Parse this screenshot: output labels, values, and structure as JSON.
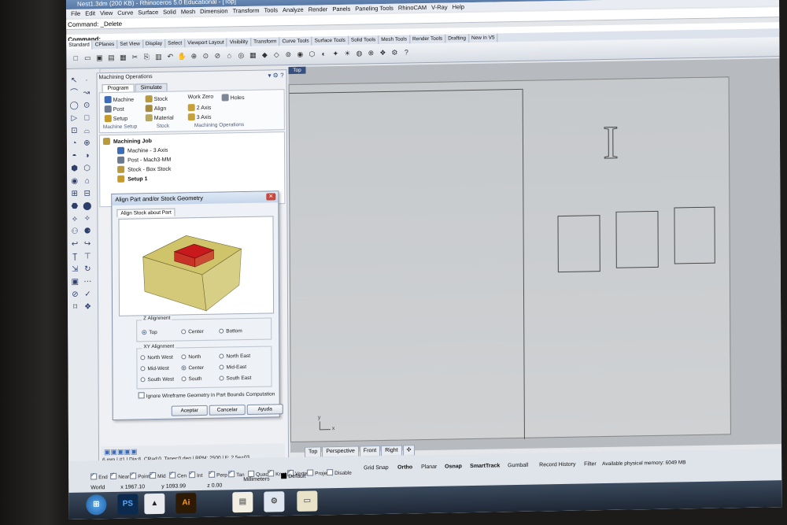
{
  "window": {
    "title": "Nest1.3dm (200 KB) - Rhinoceros 5.0 Educational - [Top]"
  },
  "menu": [
    "File",
    "Edit",
    "View",
    "Curve",
    "Surface",
    "Solid",
    "Mesh",
    "Dimension",
    "Transform",
    "Tools",
    "Analyze",
    "Render",
    "Panels",
    "Paneling Tools",
    "RhinoCAM",
    "V-Ray",
    "Help"
  ],
  "command_history": "Command: _Delete",
  "command_prompt": "Command:",
  "toolbar_tabs": [
    "Standard",
    "CPlanes",
    "Set View",
    "Display",
    "Select",
    "Viewport Layout",
    "Visibility",
    "Transform",
    "Curve Tools",
    "Surface Tools",
    "Solid Tools",
    "Mesh Tools",
    "Render Tools",
    "Drafting",
    "New in V5"
  ],
  "panel": {
    "title": "Machining Operations",
    "tabs": [
      "Program",
      "Simulate"
    ],
    "ribbon": {
      "machine": "Machine",
      "post": "Post",
      "setup": "Setup",
      "stock": "Stock",
      "align": "Align",
      "material": "Material",
      "work_zero": "Work Zero",
      "holes": "Holes",
      "two_axis": "2 Axis",
      "three_axis": "3 Axis",
      "group_setup": "Machine Setup",
      "group_stock": "Stock",
      "group_ops": "Machining Operations"
    },
    "tree": {
      "root": "Machining Job",
      "items": [
        "Machine - 3 Axis",
        "Post - Mach3-MM",
        "Stock - Box Stock",
        "Setup 1"
      ]
    },
    "status_line": "6 mm | #1 | Dia:6, CRad:0, Taper:0 deg | RPM: 2500 | F: 2.5e+03"
  },
  "dialog": {
    "title": "Align Part and/or Stock Geometry",
    "tab": "Align Stock about Part",
    "z_alignment": {
      "label": "Z Alignment",
      "options": [
        "Top",
        "Center",
        "Bottom"
      ],
      "selected": "Top"
    },
    "xy_alignment": {
      "label": "XY Alignment",
      "options": [
        "North West",
        "North",
        "North East",
        "Mid-West",
        "Center",
        "Mid-East",
        "South West",
        "South",
        "South East"
      ],
      "selected": "Center"
    },
    "ignore_label": "Ignore Wireframe Geometry in Part Bounds Computation",
    "buttons": {
      "ok": "Aceptar",
      "cancel": "Cancelar",
      "help": "Ayuda"
    },
    "colors": {
      "stock": "#cfc46a",
      "part": "#c8191c"
    }
  },
  "viewport": {
    "label": "Top",
    "tabs": [
      "Top",
      "Perspective",
      "Front",
      "Right"
    ],
    "drawn_letter": "I",
    "axis_y": "y",
    "axis_x": "x"
  },
  "osnaps": [
    {
      "label": "End",
      "on": true
    },
    {
      "label": "Near",
      "on": true
    },
    {
      "label": "Point",
      "on": true
    },
    {
      "label": "Mid",
      "on": true
    },
    {
      "label": "Cen",
      "on": true
    },
    {
      "label": "Int",
      "on": true
    },
    {
      "label": "Perp",
      "on": true
    },
    {
      "label": "Tan",
      "on": true
    },
    {
      "label": "Quad",
      "on": false
    },
    {
      "label": "Knot",
      "on": true
    },
    {
      "label": "Vertex",
      "on": true
    },
    {
      "label": "Project",
      "on": false
    },
    {
      "label": "Disable",
      "on": false
    }
  ],
  "statusbar": {
    "cplane": "World",
    "x": "x 1967.10",
    "y": "y 1093.99",
    "z": "z 0.00",
    "units": "Millimeters",
    "layer": "Default",
    "toggles": [
      "Grid Snap",
      "Ortho",
      "Planar",
      "Osnap",
      "SmartTrack",
      "Gumball",
      "Record History",
      "Filter"
    ],
    "memory": "Available physical memory: 6049 MB"
  },
  "taskbar": [
    "PS",
    "Ai"
  ]
}
